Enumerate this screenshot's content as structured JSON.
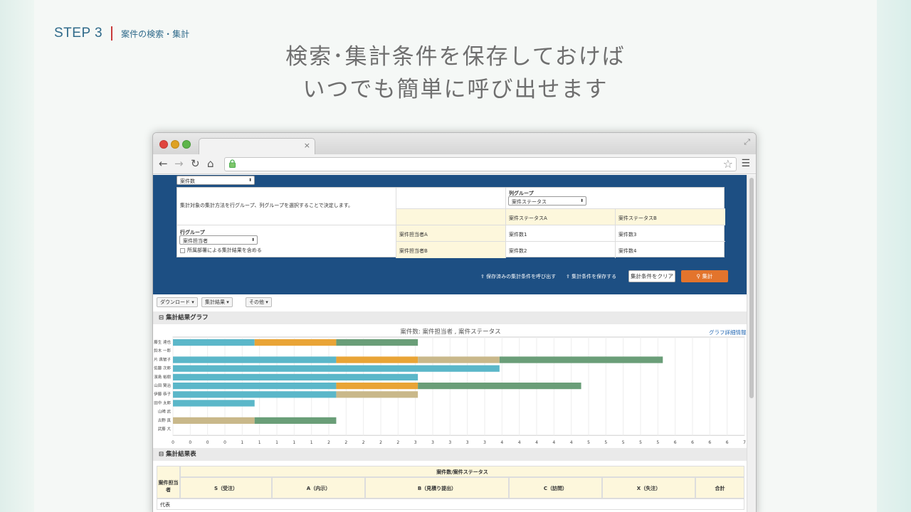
{
  "slide": {
    "step_num": "STEP 3",
    "step_title": "案件の検索・集計",
    "headline_1": "検索･集計条件を保存しておけば",
    "headline_2": "いつでも簡単に呼び出せます"
  },
  "browser": {
    "tab_close": "×",
    "icons": {
      "back": "back-arrow-icon",
      "forward": "forward-arrow-icon",
      "reload": "reload-icon",
      "home": "home-icon",
      "lock": "lock-icon",
      "star": "star-icon",
      "menu": "menu-icon"
    }
  },
  "config": {
    "top_select": "案件数",
    "description": "集計対象の集計方法を行グループ、列グループを選択することで決定します。",
    "col_group_label": "列グループ",
    "col_group_value": "案件ステータス",
    "col_headers": [
      "案件ステータスA",
      "案件ステータスB"
    ],
    "row_group_label": "行グループ",
    "row_group_value": "案件担当者",
    "include_dept_label": "所属部署による集計結果を含める",
    "rows": [
      {
        "label": "案件担当者A",
        "a": "案件数1",
        "b": "案件数3"
      },
      {
        "label": "案件担当者B",
        "a": "案件数2",
        "b": "案件数4"
      }
    ]
  },
  "actions": {
    "load_saved": "保存済みの集計条件を呼び出す",
    "save": "集計条件を保存する",
    "clear": "集計条件をクリア",
    "run": "集計"
  },
  "dropdowns": [
    "ダウンロード ▾",
    "集計結果 ▾",
    "その他 ▾"
  ],
  "graph_section": "集計結果グラフ",
  "graph_link": "グラフ詳細情報",
  "table_section": "集計結果表",
  "colors": {
    "teal": "#5bb7c9",
    "orange": "#e9a436",
    "green": "#6a9e78",
    "tan": "#c9b88a",
    "blue": "#1d4f83"
  },
  "chart_data": {
    "type": "bar",
    "title": "案件数: 案件担当者 , 案件ステータス",
    "orientation": "horizontal-stacked",
    "categories": [
      "藤生 達也",
      "鈴木 一郎",
      "片 真智子",
      "佐藤 次郎",
      "濱島 裕樹",
      "山田 賢治",
      "伊藤 恭子",
      "田中 太郎",
      "山崎 武",
      "古野 真",
      "武藤 大"
    ],
    "series": [
      {
        "color": "#5bb7c9",
        "values": [
          1,
          0,
          2,
          4,
          3,
          2,
          2,
          1,
          0,
          0,
          0
        ]
      },
      {
        "color": "#e9a436",
        "values": [
          1,
          0,
          1,
          0,
          0,
          1,
          0,
          0,
          0,
          0,
          0
        ]
      },
      {
        "color": "#c9b88a",
        "values": [
          0,
          0,
          1,
          0,
          0,
          0,
          1,
          0,
          0,
          1,
          0
        ]
      },
      {
        "color": "#6a9e78",
        "values": [
          1,
          0,
          2,
          0,
          0,
          2,
          0,
          0,
          0,
          1,
          0
        ]
      }
    ],
    "x_ticks": [
      "0",
      "0",
      "0",
      "0",
      "1",
      "1",
      "1",
      "1",
      "1",
      "2",
      "2",
      "2",
      "2",
      "2",
      "3",
      "3",
      "3",
      "3",
      "3",
      "4",
      "4",
      "4",
      "4",
      "4",
      "5",
      "5",
      "5",
      "5",
      "5",
      "6",
      "6",
      "6",
      "6",
      "7"
    ],
    "xlim": [
      0,
      7
    ]
  },
  "result_table": {
    "group_header": "案件数/案件ステータス",
    "row_header": "案件担当者",
    "columns": [
      "S（受注）",
      "A（内示）",
      "B（見積り提出）",
      "C（訪問）",
      "X（失注）",
      "合計"
    ],
    "first_row_label": "代表"
  }
}
